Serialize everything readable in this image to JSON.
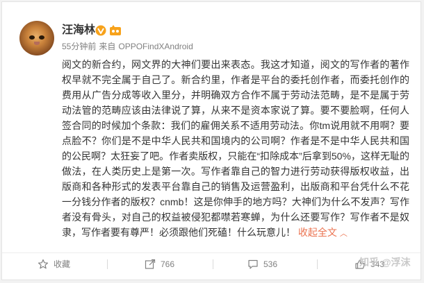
{
  "post": {
    "author": "汪海林",
    "time": "55分钟前",
    "via": "来自",
    "device": "OPPOFindXAndroid",
    "content": "阅文的新合约，网文界的大神们要出来表态。我这才知道，阅文的写作者的著作权早就不完全属于自己了。新合约里，作者是平台的委托创作者，而委托创作的费用从广告分成等收入里分，并明确双方合作不属于劳动法范畴，是不是属于劳动法管的范畴应该由法律说了算，从来不是资本家说了算。要不要脸啊，任何人签合同的时候加个条款：我们的雇佣关系不适用劳动法。你tm说用就不用啊？要点脸不？你们是不是中华人民共和国境内的公司啊？作者是不是中华人民共和国的公民啊？太狂妄了吧。作者卖版权，只能在“扣除成本”后拿到50%，这样无耻的做法，在人类历史上是第一次。写作者靠自己的智力进行劳动获得版权收益，出版商和各种形式的发表平台靠自己的销售及运营盈利，出版商和平台凭什么不花一分钱分作者的版权？cnmb！这是你伸手的地方吗？大神们为什么不发声？写作者没有骨头，对自己的权益被侵犯都噤若寒蝉，为什么还要写作？写作者不是奴隶，写作者要有尊严！必须跟他们死磕！什么玩意儿！",
    "collapse_label": "收起全文",
    "collapse_arrow": "︿"
  },
  "actions": {
    "favorite": "收藏",
    "repost": "766",
    "comment": "536",
    "like": "343"
  },
  "watermark": "知乎 @浮沫",
  "colors": {
    "link": "#eb7350",
    "text": "#333333",
    "meta": "#808080",
    "verified": "#f7a21b"
  }
}
